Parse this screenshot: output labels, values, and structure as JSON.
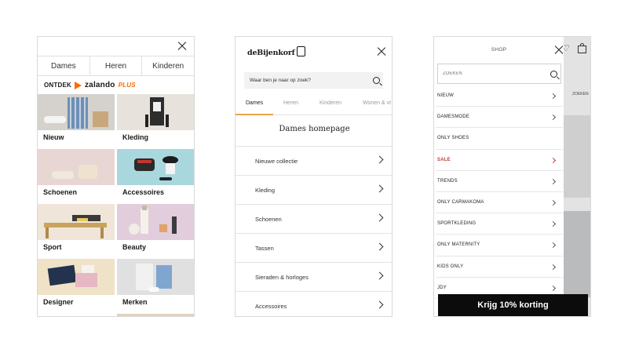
{
  "zalando": {
    "tabs": [
      "Dames",
      "Heren",
      "Kinderen"
    ],
    "brand": {
      "prefix": "ONTDEK",
      "name": "zalando",
      "suffix": "PLUS"
    },
    "tiles": [
      "Nieuw",
      "Kleding",
      "Schoenen",
      "Accessoires",
      "Sport",
      "Beauty",
      "Designer",
      "Merken"
    ],
    "colors": {
      "accent": "#ff6900"
    }
  },
  "bijenkorf": {
    "logo": "deBijenkorf",
    "search_placeholder": "Waar ben je naar op zoek?",
    "tabs": [
      "Dames",
      "Heren",
      "Kinderen",
      "Wonen & vr"
    ],
    "active_tab": "Dames",
    "title": "Dames homepage",
    "items": [
      "Nieuwe collectie",
      "Kleding",
      "Schoenen",
      "Tassen",
      "Sieraden & horloges",
      "Accessoires"
    ],
    "colors": {
      "accent": "#e6a646"
    }
  },
  "only": {
    "title": "SHOP",
    "search_placeholder": "ZOEKEN",
    "background_text": "ZOEKEN",
    "items": [
      "NIEUW",
      "DAMESMODE",
      "ONLY SHOES",
      "SALE",
      "TRENDS",
      "ONLY CARMAKOMA",
      "SPORTKLEDING",
      "ONLY MATERNITY",
      "KIDS ONLY",
      "JDY"
    ],
    "cta": "Krijg 10% korting",
    "colors": {
      "sale": "#d0362e",
      "cta_bg": "#0c0c0c"
    }
  }
}
